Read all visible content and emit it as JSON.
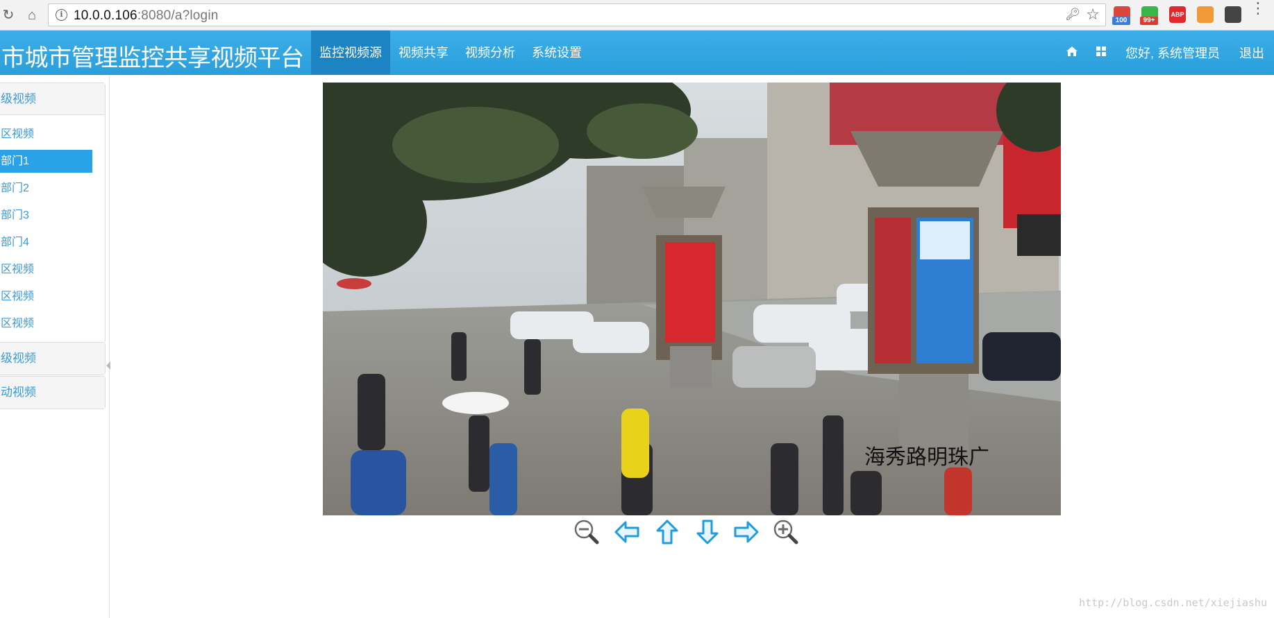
{
  "browser": {
    "url_host": "10.0.0.106",
    "url_rest": ":8080/a?login",
    "extensions": [
      {
        "name": "extension-1",
        "badge": "100",
        "color": "#d9463b",
        "badge_color": "#3b7ddd"
      },
      {
        "name": "extension-2",
        "badge": "99+",
        "color": "#3ab549",
        "badge_color": "#e0382f"
      },
      {
        "name": "adblock-plus",
        "badge": "",
        "color": "#e0282e",
        "label": "ABP"
      },
      {
        "name": "extension-4",
        "badge": "",
        "color": "#f29a38"
      },
      {
        "name": "extension-5",
        "badge": "",
        "color": "#444"
      }
    ]
  },
  "header": {
    "brand": "市城市管理监控共享视频平台",
    "nav": [
      "监控视频源",
      "视频共享",
      "视频分析",
      "系统设置"
    ],
    "active_nav": "监控视频源",
    "greeting": "您好, 系统管理员",
    "logout": "退出"
  },
  "sidebar": {
    "panel1": {
      "title": "级视频",
      "items": [
        "区视频",
        "部门1",
        "部门2",
        "部门3",
        "部门4",
        "区视频",
        "区视频",
        "区视频"
      ],
      "active_index": 1
    },
    "panel2": {
      "title": "级视频"
    },
    "panel3": {
      "title": "动视频"
    }
  },
  "video": {
    "overlay_text": "海秀路明珠广"
  },
  "ptz_controls": [
    "zoom-out",
    "pan-left",
    "tilt-up",
    "tilt-down",
    "pan-right",
    "zoom-in"
  ],
  "watermark": "http://blog.csdn.net/xiejiashu",
  "colors": {
    "header_bg": "#2fa4e7",
    "nav_active": "#1c84c2",
    "sidebar_active": "#2aa2e8",
    "link": "#3a9ad9"
  }
}
